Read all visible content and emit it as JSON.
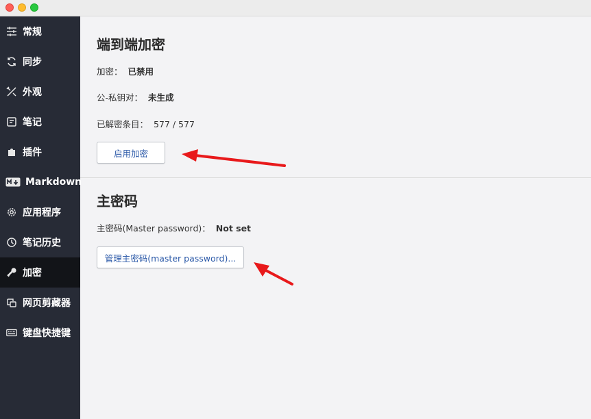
{
  "window": {
    "buttons": [
      "close",
      "minimize",
      "zoom"
    ]
  },
  "sidebar": {
    "items": [
      {
        "label": "常规",
        "icon": "sliders-icon"
      },
      {
        "label": "同步",
        "icon": "sync-icon"
      },
      {
        "label": "外观",
        "icon": "brush-icon"
      },
      {
        "label": "笔记",
        "icon": "note-icon"
      },
      {
        "label": "插件",
        "icon": "puzzle-icon"
      },
      {
        "label": "Markdown",
        "icon": "markdown-icon"
      },
      {
        "label": "应用程序",
        "icon": "gear-icon"
      },
      {
        "label": "笔记历史",
        "icon": "history-icon"
      },
      {
        "label": "加密",
        "icon": "key-icon",
        "active": true
      },
      {
        "label": "网页剪藏器",
        "icon": "clipper-icon"
      },
      {
        "label": "键盘快捷键",
        "icon": "keyboard-icon"
      }
    ]
  },
  "e2ee": {
    "title": "端到端加密",
    "encryption_label": "加密：",
    "encryption_value": "已禁用",
    "keypair_label": "公-私钥对：",
    "keypair_value": "未生成",
    "decrypted_label": "已解密条目：",
    "decrypted_value": "577 / 577",
    "enable_button": "启用加密"
  },
  "master": {
    "title": "主密码",
    "password_label": "主密码(Master password)：",
    "password_value": "Not set",
    "manage_button": "管理主密码(master password)..."
  },
  "colors": {
    "sidebar_bg": "#272b36",
    "sidebar_active_bg": "#121418",
    "content_bg": "#f3f3f5",
    "button_text": "#2b59a8",
    "annotation_arrow": "#e8191b"
  }
}
